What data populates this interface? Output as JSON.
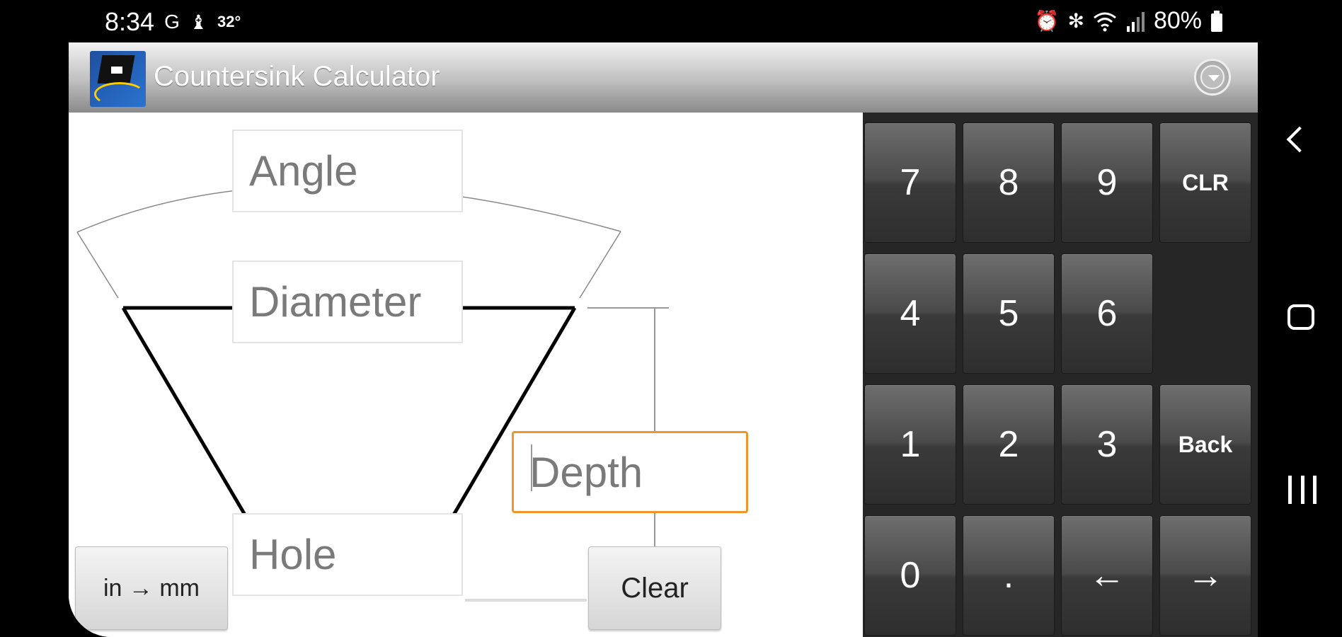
{
  "status_bar": {
    "time": "8:34",
    "left_icons": [
      "G",
      "♝"
    ],
    "temperature": "32°",
    "right_icons": [
      "⏰",
      "✻",
      "wifi",
      "signal"
    ],
    "battery": "80%"
  },
  "app": {
    "title": "Countersink Calculator",
    "menu_icon": "overflow-menu-icon"
  },
  "fields": {
    "angle": "Angle",
    "diameter": "Diameter",
    "depth": "Depth",
    "hole": "Hole"
  },
  "buttons": {
    "units": "in → mm",
    "clear": "Clear"
  },
  "keypad": {
    "k7": "7",
    "k8": "8",
    "k9": "9",
    "clr": "CLR",
    "k4": "4",
    "k5": "5",
    "k6": "6",
    "k1": "1",
    "k2": "2",
    "k3": "3",
    "back": "Back",
    "k0": "0",
    "dot": ".",
    "left": "←",
    "right": "→"
  },
  "colors": {
    "focus_border": "#f2942b",
    "keypad_bg": "#262626"
  }
}
